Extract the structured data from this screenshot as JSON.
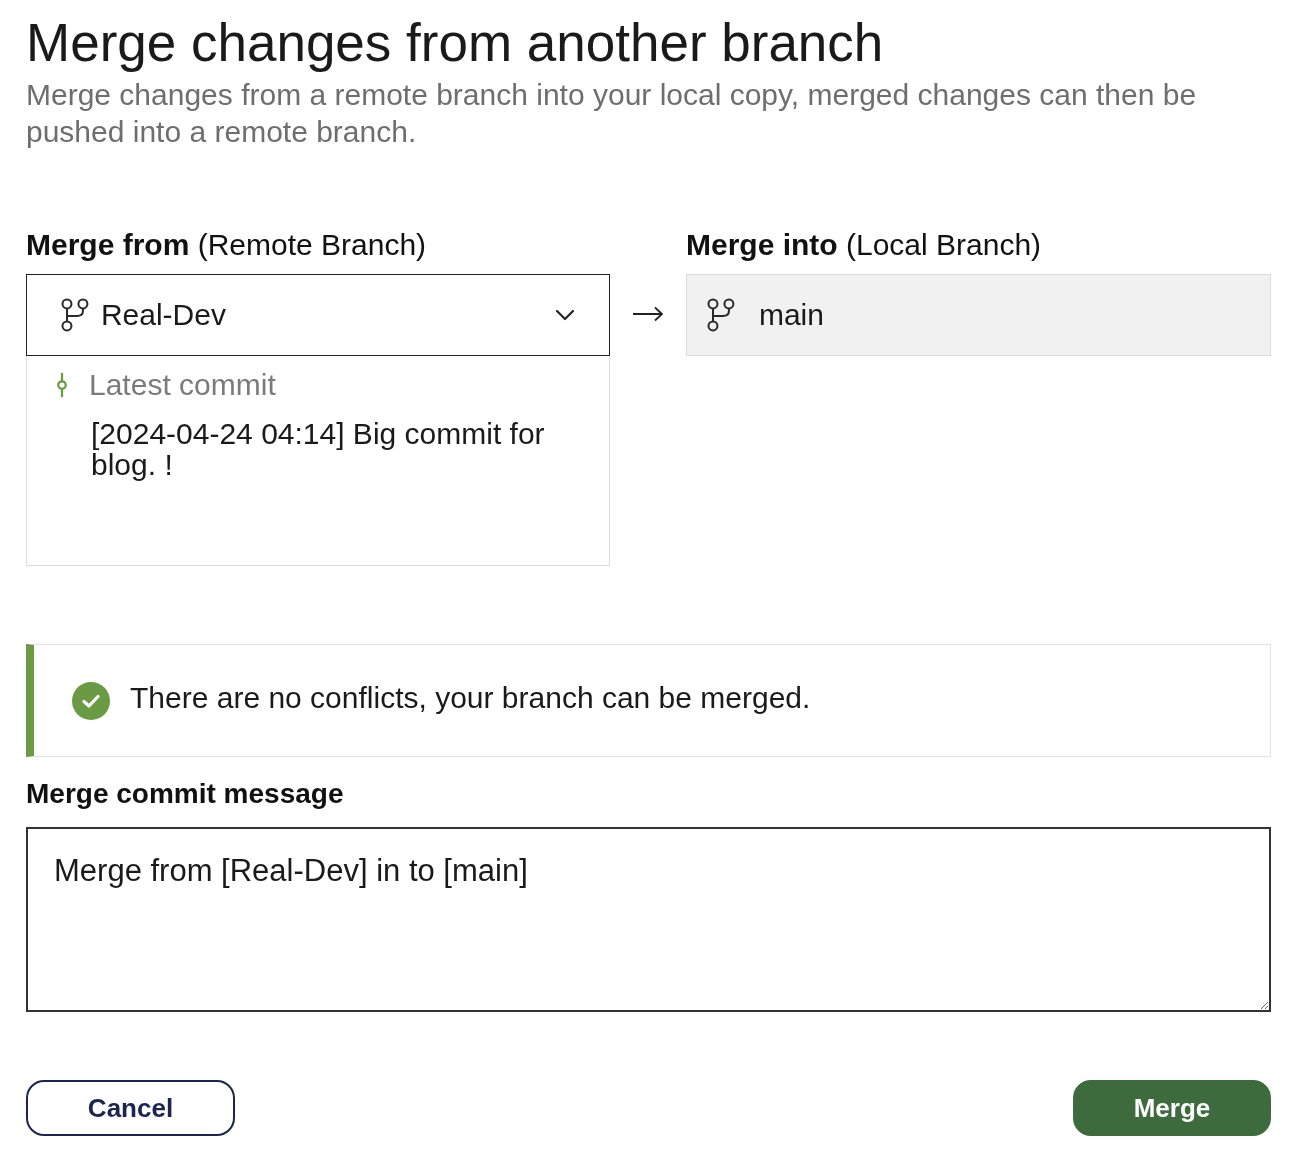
{
  "page": {
    "title": "Merge changes from another branch",
    "subtitle": "Merge changes from a remote branch into your local copy, merged changes can then be pushed into a remote branch."
  },
  "merge_from": {
    "label": "**Merge from** (Remote Branch)",
    "branch": "Real-Dev",
    "latest_commit": {
      "label": "Latest commit",
      "message": "[2024-04-24 04:14] Big commit for blog. !"
    }
  },
  "merge_into": {
    "label": "**Merge into** (Local Branch)",
    "branch": "main",
    "disabled": true
  },
  "status": {
    "kind": "success",
    "message": "There are no conflicts, your branch can be merged."
  },
  "commit_message": {
    "label": "Merge commit message",
    "value": "Merge from [Real-Dev] in to [main]"
  },
  "buttons": [
    {
      "label": "Cancel",
      "kind": "secondary"
    },
    {
      "label": "Merge",
      "kind": "primary"
    }
  ]
}
